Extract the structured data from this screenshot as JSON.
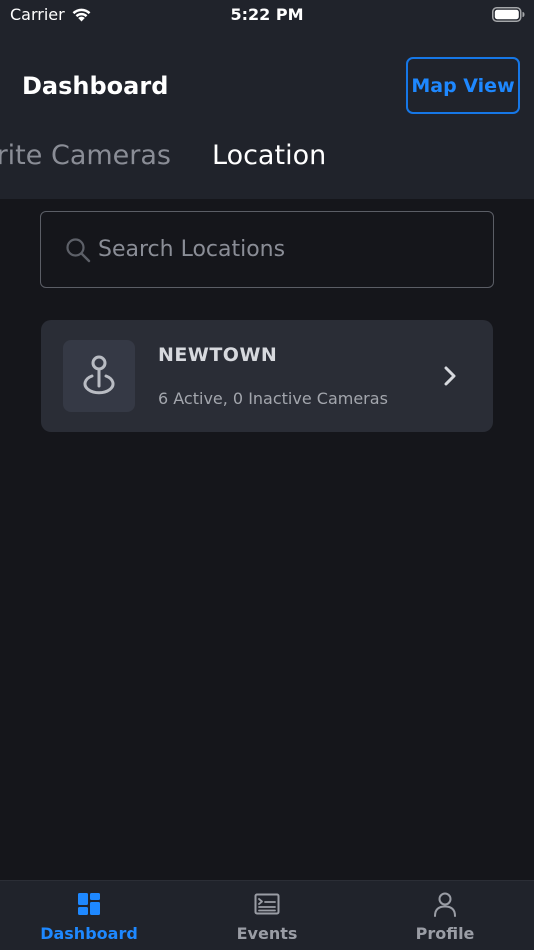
{
  "status_bar": {
    "carrier": "Carrier",
    "time": "5:22 PM"
  },
  "header": {
    "title": "Dashboard",
    "map_view_label": "Map View"
  },
  "tabs": [
    {
      "label": "Favourite Cameras",
      "active": false
    },
    {
      "label": "Location",
      "active": true
    }
  ],
  "search": {
    "placeholder": "Search Locations",
    "value": ""
  },
  "locations": [
    {
      "name": "NEWTOWN",
      "summary": "6 Active, 0 Inactive Cameras"
    }
  ],
  "bottom_tabs": [
    {
      "label": "Dashboard",
      "icon": "dashboard-grid-icon",
      "active": true
    },
    {
      "label": "Events",
      "icon": "events-terminal-icon",
      "active": false
    },
    {
      "label": "Profile",
      "icon": "profile-person-icon",
      "active": false
    }
  ],
  "colors": {
    "accent": "#1e88ff",
    "background": "#15161b",
    "header": "#20232b",
    "card": "#2a2d36"
  }
}
